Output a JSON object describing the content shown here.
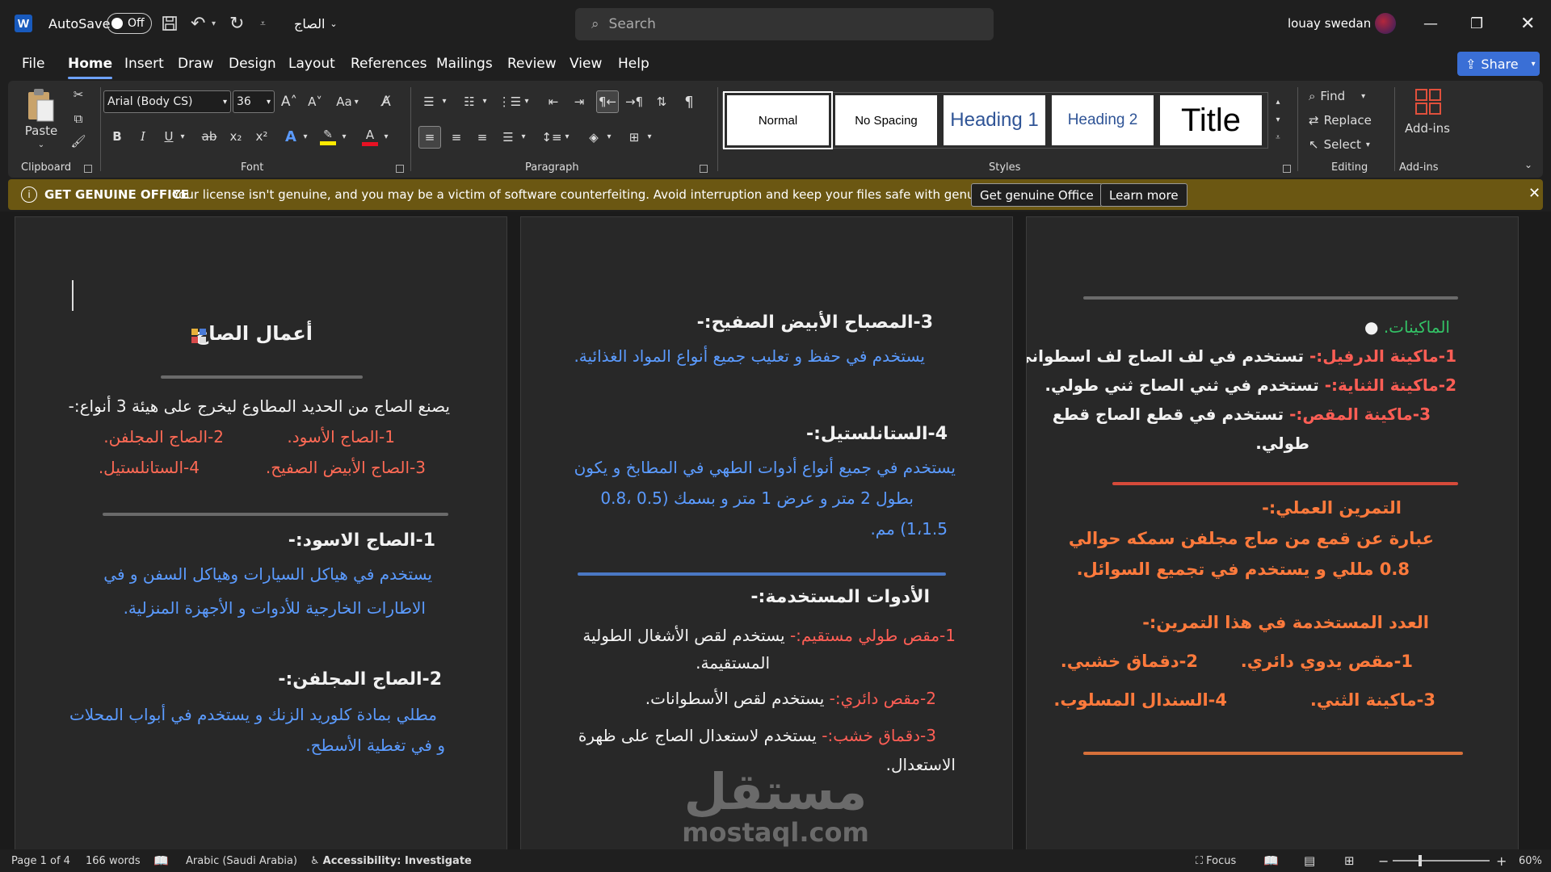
{
  "titlebar": {
    "app_icon": "W",
    "autosave_label": "AutoSave",
    "autosave_state": "Off",
    "document_name": "الصاج",
    "search_placeholder": "Search",
    "user_name": "louay swedan"
  },
  "menu": {
    "tabs": [
      "File",
      "Home",
      "Insert",
      "Draw",
      "Design",
      "Layout",
      "References",
      "Mailings",
      "Review",
      "View",
      "Help"
    ],
    "active": "Home",
    "share_label": "Share"
  },
  "ribbon": {
    "clipboard": {
      "paste_label": "Paste",
      "group_label": "Clipboard"
    },
    "font": {
      "font_name": "Arial (Body CS)",
      "font_size": "36",
      "group_label": "Font",
      "case_label": "Aa"
    },
    "paragraph": {
      "group_label": "Paragraph"
    },
    "styles": {
      "group_label": "Styles",
      "items": [
        "Normal",
        "No Spacing",
        "Heading 1",
        "Heading 2",
        "Title"
      ],
      "selected": "Normal"
    },
    "editing": {
      "find_label": "Find",
      "replace_label": "Replace",
      "select_label": "Select",
      "group_label": "Editing"
    },
    "addins": {
      "button_label": "Add-ins",
      "group_label": "Add-ins"
    }
  },
  "infobar": {
    "title": "GET GENUINE OFFICE",
    "message": "Your license isn't genuine, and you may be a victim of software counterfeiting. Avoid interruption and keep your files safe with genuine Office today.",
    "primary_button": "Get genuine Office",
    "secondary_button": "Learn more",
    "color": "#6b5712"
  },
  "page1": {
    "title": "أعمال الصاج",
    "intro": "يصنع الصاج من الحديد المطاوع ليخرج على هيئة 3 أنواع:-",
    "type1": "1-الصاج الأسود.",
    "type2": "2-الصاج المجلفن.",
    "type3": "3-الصاج الأبيض الصفيح.",
    "type4": "4-الستانلستيل.",
    "h1": "1-الصاج الاسود:-",
    "p1_l1": "يستخدم في هياكل السيارات وهياكل السفن و في",
    "p1_l2": "الاطارات الخارجية للأدوات و الأجهزة المنزلية.",
    "h2": "2-الصاج المجلفن:-",
    "p2_l1": "مطلي بمادة كلوريد الزنك و يستخدم في أبواب المحلات",
    "p2_l2": "و في تغطية الأسطح."
  },
  "page2": {
    "h3": "3-المصباح الأبيض الصفيح:-",
    "p3": "يستخدم في حفظ و تعليب جميع أنواع المواد الغذائية.",
    "h4": "4-الستانلستيل:-",
    "p4_l1": "يستخدم في جميع أنواع أدوات الطهي في المطابخ و يكون",
    "p4_l2": "بطول 2 متر و عرض 1 متر و بسمك (0.5 ،0.8",
    "p4_l3": "1،1.5) مم.",
    "tools_heading": "الأدوات المستخدمة:-",
    "tool1_name": "1-مقص طولي مستقيم:-",
    "tool1_desc": "يستخدم لقص الأشغال الطولية",
    "tool1_desc2": "المستقيمة.",
    "tool2_name": "2-مقص دائري:-",
    "tool2_desc": "يستخدم لقص الأسطوانات.",
    "tool3_name": "3-دقماق خشب:-",
    "tool3_desc": "يستخدم لاستعدال الصاج على ظهرة",
    "tool3_desc2": "الاستعدال."
  },
  "page3": {
    "machines_label": "الماكينات.",
    "m1_name": "1-ماكينة الدرفيل:-",
    "m1_desc": "تستخدم في لف الصاج لف اسطواني.",
    "m2_name": "2-ماكينة الثناية:-",
    "m2_desc": "تستخدم في ثني الصاج ثني طولي.",
    "m3_name": "3-ماكينة المقص:-",
    "m3_desc": "تستخدم في قطع الصاج قطع",
    "m3_desc2": "طولي.",
    "exercise_heading": "التمرين العملي:-",
    "exercise_l1": "عبارة عن قمع من صاج مجلفن سمكه حوالي",
    "exercise_l2": "0.8 مللي و يستخدم في تجميع السوائل.",
    "tools_heading": "العدد المستخدمة في هذا التمرين:-",
    "t1": "1-مقص يدوي دائري.",
    "t2": "2-دقماق خشبي.",
    "t3": "3-ماكينة الثني.",
    "t4": "4-السندال المسلوب."
  },
  "watermark": {
    "arabic": "مستقل",
    "latin": "mostaql.com"
  },
  "statusbar": {
    "page": "Page 1 of 4",
    "words": "166 words",
    "language": "Arabic (Saudi Arabia)",
    "accessibility": "Accessibility: Investigate",
    "focus": "Focus",
    "zoom": "60%"
  }
}
